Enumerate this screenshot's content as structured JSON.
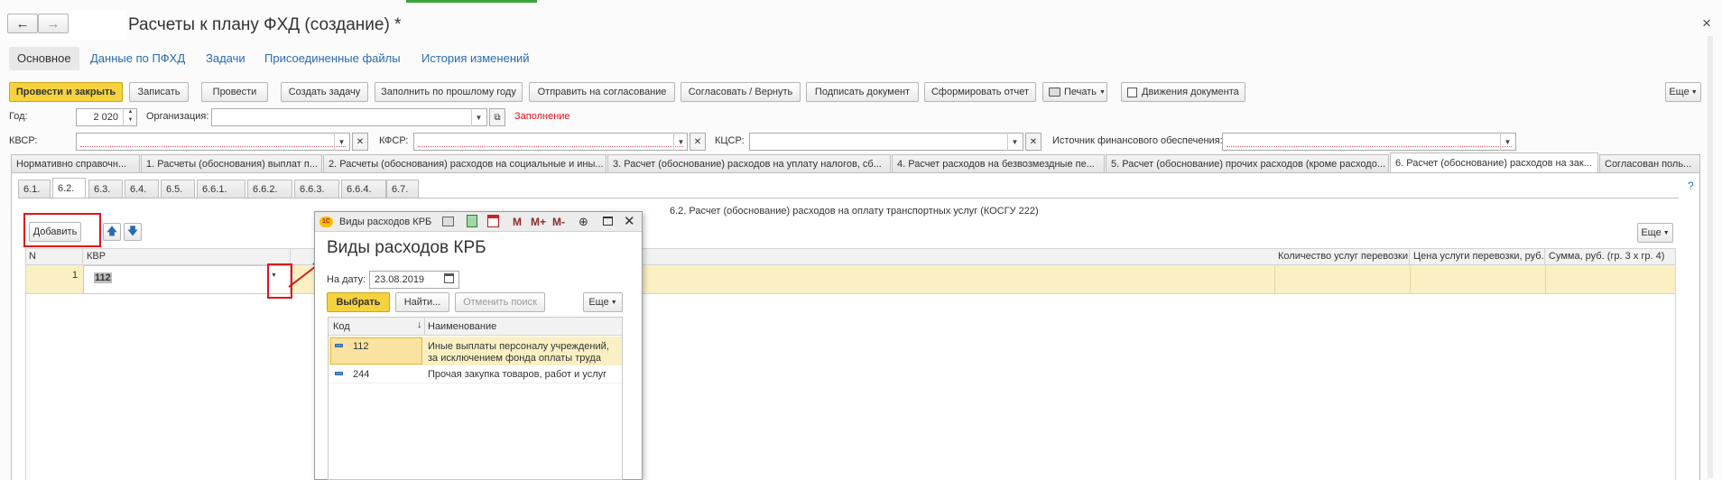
{
  "window": {
    "title": "Расчеты к плану ФХД (создание) *",
    "close_glyph": "×"
  },
  "nav_tabs": [
    {
      "label": "Основное"
    },
    {
      "label": "Данные по ПФХД"
    },
    {
      "label": "Задачи"
    },
    {
      "label": "Присоединенные файлы"
    },
    {
      "label": "История изменений"
    }
  ],
  "toolbar": {
    "post_close": "Провести и закрыть",
    "save": "Записать",
    "post": "Провести",
    "create_task": "Создать задачу",
    "fill_prev": "Заполнить по прошлому году",
    "send_approval": "Отправить на согласование",
    "approve_return": "Согласовать / Вернуть",
    "sign": "Подписать документ",
    "report": "Сформировать отчет",
    "print": "Печать",
    "movements": "Движения документа",
    "more": "Еще"
  },
  "form": {
    "year_label": "Год:",
    "year_value": "2 020",
    "org_label": "Организация:",
    "org_value": "",
    "fill_status": "Заполнение",
    "kvsr_label": "КВСР:",
    "kfsr_label": "КФСР:",
    "kcsr_label": "КЦСР:",
    "source_label": "Источник финансового обеспечения:"
  },
  "doc_tabs": [
    {
      "label": "Нормативно справочн..."
    },
    {
      "label": "1. Расчеты (обоснования) выплат п..."
    },
    {
      "label": "2. Расчеты (обоснования) расходов на социальные и ины..."
    },
    {
      "label": "3. Расчет (обоснование) расходов на уплату налогов, сб..."
    },
    {
      "label": "4. Расчет расходов на безвозмездные пе..."
    },
    {
      "label": "5. Расчет (обоснование) прочих расходов (кроме расходо..."
    },
    {
      "label": "6. Расчет (обоснование) расходов на зак..."
    },
    {
      "label": "Согласован поль..."
    }
  ],
  "sub_tabs": [
    {
      "label": "6.1."
    },
    {
      "label": "6.2."
    },
    {
      "label": "6.3."
    },
    {
      "label": "6.4."
    },
    {
      "label": "6.5."
    },
    {
      "label": "6.6.1."
    },
    {
      "label": "6.6.2."
    },
    {
      "label": "6.6.3."
    },
    {
      "label": "6.6.4."
    },
    {
      "label": "6.7."
    }
  ],
  "section": {
    "title": "6.2. Расчет (обоснование) расходов на оплату транспортных услуг (КОСГУ 222)",
    "help": "?",
    "add_button": "Добавить",
    "more": "Еще"
  },
  "table": {
    "columns": {
      "n": "N",
      "kvr": "КВР",
      "qty": "Количество услуг перевозки",
      "price": "Цена услуги перевозки, руб.",
      "sum": "Сумма, руб. (гр. 3 x гр. 4)"
    },
    "rows": [
      {
        "n": "1",
        "kvr": "112"
      }
    ]
  },
  "popup": {
    "app_icon": "1С",
    "caption": "Виды расходов КРБ",
    "heading": "Виды расходов КРБ",
    "date_label": "На дату:",
    "date_value": "23.08.2019",
    "select": "Выбрать",
    "find": "Найти...",
    "cancel_search": "Отменить поиск",
    "more": "Еще",
    "tb_m": "M",
    "tb_mplus": "M+",
    "tb_mminus": "M-",
    "col_code": "Код",
    "col_name": "Наименование",
    "rows": [
      {
        "code": "112",
        "name_line1": "Иные выплаты персоналу учреждений,",
        "name_line2": "за исключением фонда оплаты труда"
      },
      {
        "code": "244",
        "name_line1": "Прочая закупка товаров, работ и услуг",
        "name_line2": ""
      }
    ]
  },
  "colors": {
    "accent_yellow": "#f6d23e",
    "selected_row": "#fbf0c4",
    "link_blue": "#2a6ab0",
    "annotation_red": "#e0141b",
    "status_red": "#e0141b"
  }
}
